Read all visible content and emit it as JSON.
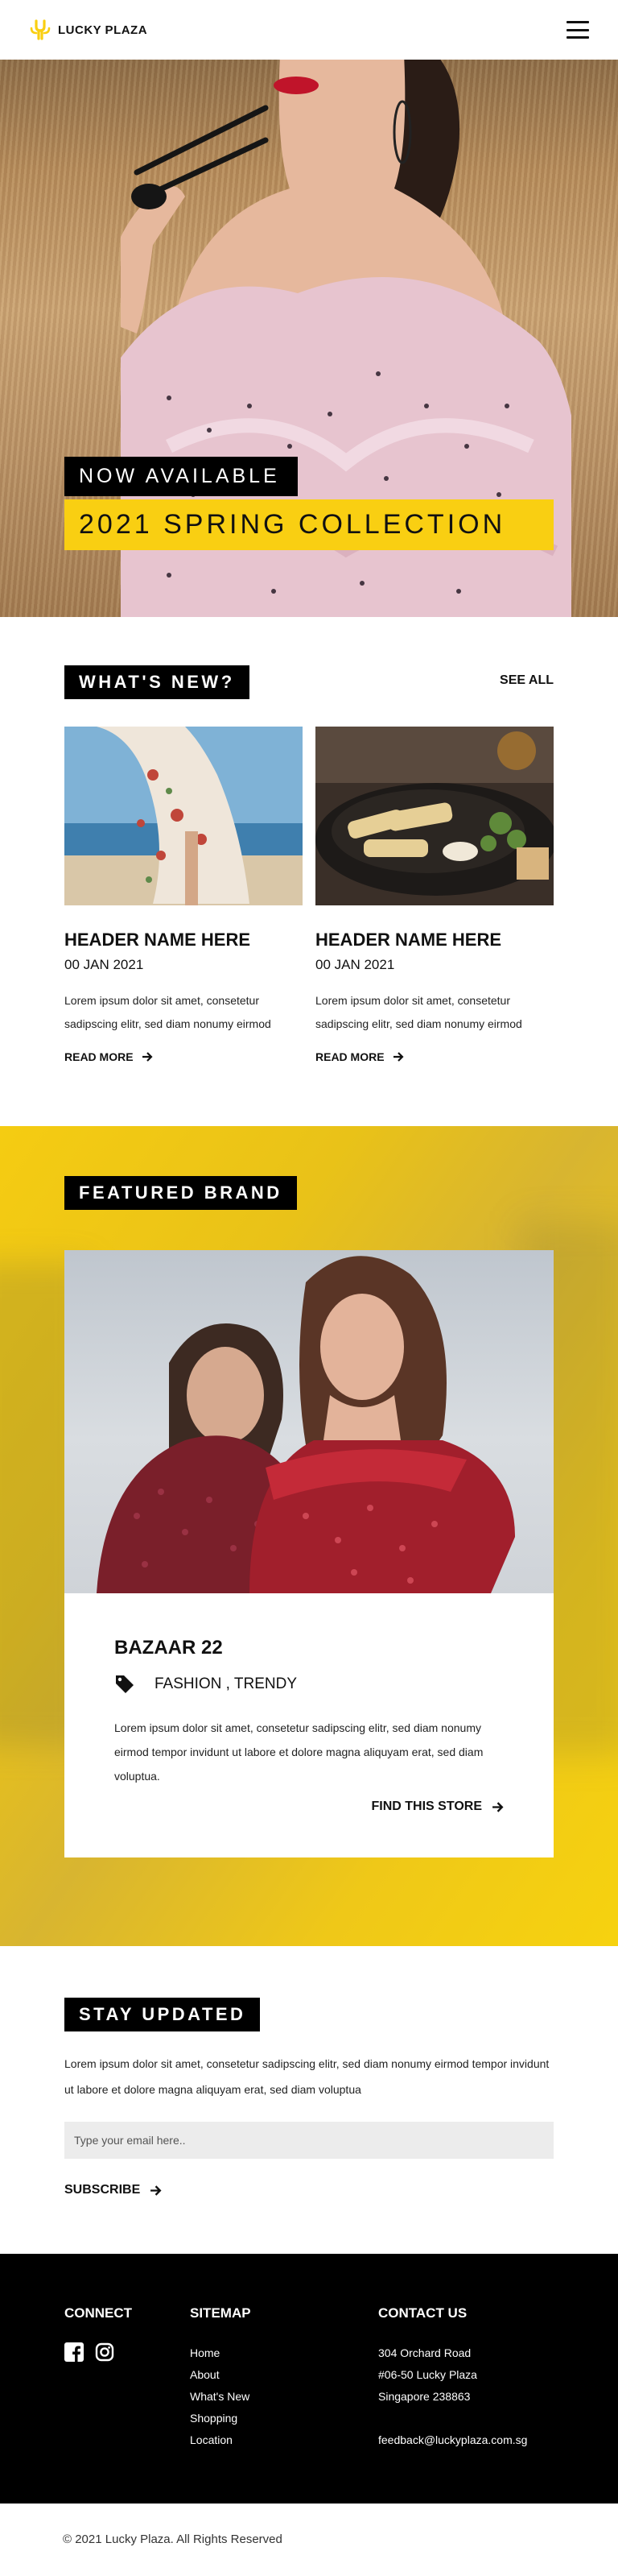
{
  "header": {
    "brand": "LUCKY PLAZA",
    "menu_icon": "hamburger-menu-icon",
    "logo_color": "#f9cf12"
  },
  "hero": {
    "tag": "NOW AVAILABLE",
    "title": "2021 SPRING COLLECTION"
  },
  "news": {
    "title": "WHAT'S NEW?",
    "see_all": "SEE ALL",
    "cards": [
      {
        "title": "HEADER NAME HERE",
        "date": "00 JAN 2021",
        "excerpt_line1": "Lorem ipsum dolor sit amet, consetetur",
        "excerpt_line2": "sadipscing elitr, sed diam nonumy eirmod",
        "more": "READ MORE"
      },
      {
        "title": "HEADER NAME HERE",
        "date": "00 JAN 2021",
        "excerpt_line1": "Lorem ipsum dolor sit amet, consetetur",
        "excerpt_line2": "sadipscing elitr, sed diam nonumy eirmod",
        "more": "READ MORE"
      }
    ]
  },
  "featured": {
    "title": "FEATURED BRAND",
    "brand_name": "BAZAAR 22",
    "tags": "FASHION , TRENDY",
    "description": "Lorem ipsum dolor sit amet, consetetur sadipscing elitr, sed diam nonumy eirmod tempor invidunt ut labore et dolore magna aliquyam erat, sed diam voluptua.",
    "cta": "FIND THIS STORE",
    "background_color": "#f9cf12"
  },
  "stay": {
    "title": "STAY UPDATED",
    "description": "Lorem ipsum dolor sit amet, consetetur sadipscing elitr, sed diam nonumy eirmod tempor invidunt ut labore et dolore magna aliquyam erat, sed diam voluptua",
    "email_placeholder": "Type your email here..",
    "subscribe": "SUBSCRIBE"
  },
  "footer": {
    "connect_title": "CONNECT",
    "social_icons": [
      "facebook-icon",
      "instagram-icon"
    ],
    "sitemap_title": "SITEMAP",
    "sitemap": [
      "Home",
      "About",
      "What's New",
      "Shopping",
      "Location"
    ],
    "contact_title": "CONTACT US",
    "address": [
      "304 Orchard Road",
      "#06-50 Lucky Plaza",
      "Singapore 238863"
    ],
    "email": "feedback@luckyplaza.com.sg"
  },
  "copyright": "© 2021 Lucky Plaza. All Rights Reserved"
}
